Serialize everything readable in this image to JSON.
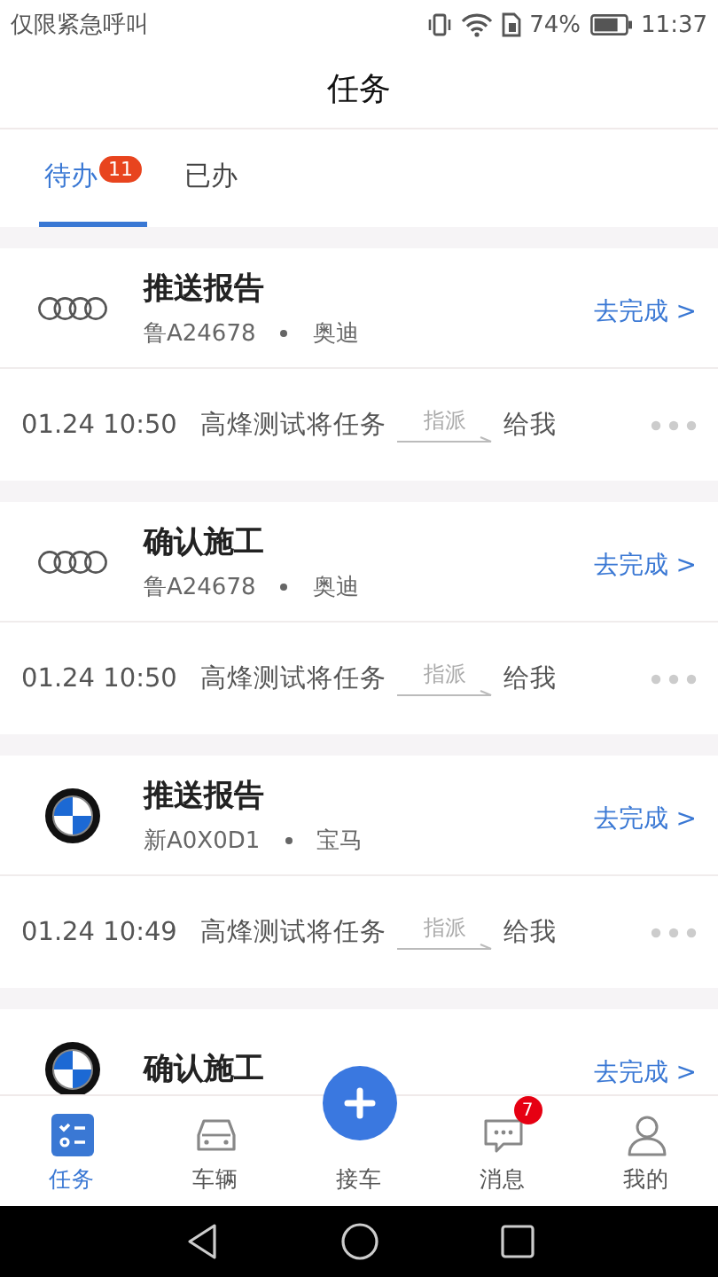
{
  "status_bar": {
    "carrier": "仅限紧急呼叫",
    "battery": "74%",
    "time": "11:37"
  },
  "header": {
    "title": "任务"
  },
  "tabs": [
    {
      "label": "待办",
      "badge": "11",
      "selected": true
    },
    {
      "label": "已办",
      "selected": false
    }
  ],
  "tasks": [
    {
      "kind": "audi",
      "title": "推送报告",
      "plate": "鲁A24678",
      "brand": "奥迪",
      "action": "去完成 >",
      "time": "01.24 10:50",
      "text_before": "高烽测试将任务",
      "assign": "指派",
      "text_after": "给我"
    },
    {
      "kind": "audi",
      "title": "确认施工",
      "plate": "鲁A24678",
      "brand": "奥迪",
      "action": "去完成 >",
      "time": "01.24 10:50",
      "text_before": "高烽测试将任务",
      "assign": "指派",
      "text_after": "给我"
    },
    {
      "kind": "bmw",
      "title": "推送报告",
      "plate": "新A0X0D1",
      "brand": "宝马",
      "action": "去完成 >",
      "time": "01.24 10:49",
      "text_before": "高烽测试将任务",
      "assign": "指派",
      "text_after": "给我"
    },
    {
      "kind": "bmw",
      "title": "确认施工",
      "action": "去完成 >"
    }
  ],
  "bottom_nav": [
    {
      "kind": "tasks",
      "label": "任务",
      "selected": true
    },
    {
      "kind": "car",
      "label": "车辆",
      "selected": false
    },
    {
      "kind": "add",
      "label": "接车",
      "selected": false
    },
    {
      "kind": "message",
      "label": "消息",
      "badge": "7",
      "selected": false
    },
    {
      "kind": "profile",
      "label": "我的",
      "selected": false
    }
  ]
}
